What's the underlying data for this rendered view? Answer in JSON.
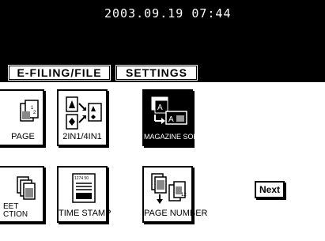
{
  "status": {
    "datetime": "2003.09.19 07:44"
  },
  "tabs": [
    {
      "label": "E-FILING/FILE"
    },
    {
      "label": "SETTINGS"
    }
  ],
  "functions": {
    "row1": [
      {
        "label": "PAGE",
        "icon": "page-split-icon"
      },
      {
        "label": "2IN1/4IN1",
        "icon": "combine-pages-icon"
      },
      {
        "label": "MAGAZINE SORT",
        "icon": "magazine-sort-icon",
        "selected": true
      }
    ],
    "row2": [
      {
        "label": "EET\nCTION",
        "icon": "sheet-insertion-icon"
      },
      {
        "label": "TIME STAMP",
        "icon": "time-stamp-icon"
      },
      {
        "label": "PAGE NUMBER",
        "icon": "page-number-icon"
      }
    ]
  },
  "timestamp_icon_text": "1274 50",
  "page_number_digits": "12",
  "nav": {
    "next_label": "Next"
  }
}
